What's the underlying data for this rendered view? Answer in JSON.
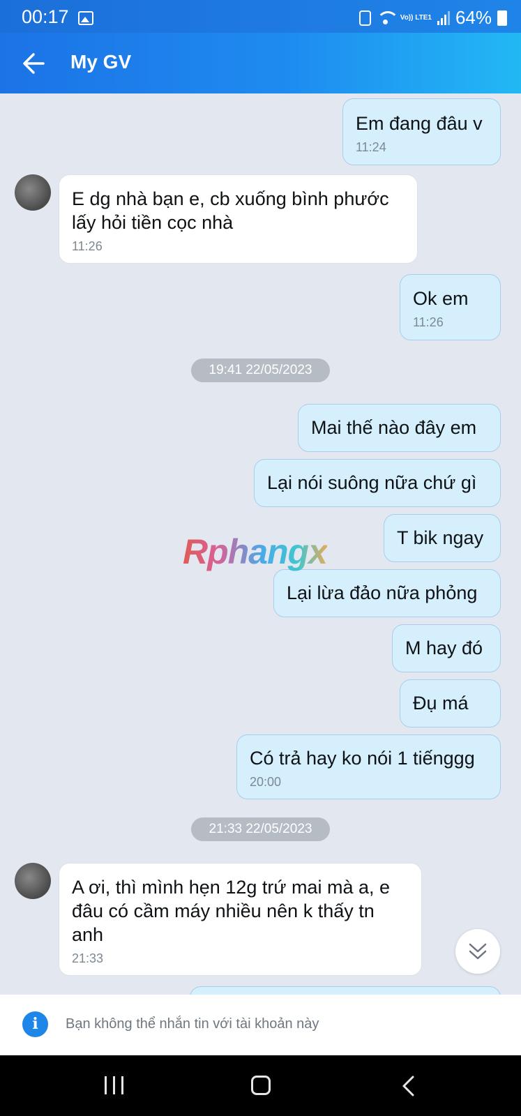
{
  "status_bar": {
    "time": "00:17",
    "battery": "64%",
    "network_label": "Vo)) LTE1"
  },
  "header": {
    "title": "My GV",
    "back_icon": "arrow-left-icon"
  },
  "messages": [
    {
      "direction": "out",
      "text": "Em đang đâu v",
      "time": "11:24"
    },
    {
      "direction": "in",
      "lines": [
        "E dg nhà bạn e, cb xuống bình phước",
        "lấy hỏi tiền cọc nhà"
      ],
      "time": "11:26"
    },
    {
      "direction": "out",
      "text": "Ok em",
      "time": "11:26"
    },
    {
      "direction": "out",
      "text": "Mai thế nào đây em"
    },
    {
      "direction": "out",
      "text": "Lại nói suông nữa chứ gì"
    },
    {
      "direction": "out",
      "text": "T bik ngay"
    },
    {
      "direction": "out",
      "text": "Lại lừa đảo nữa phỏng"
    },
    {
      "direction": "out",
      "text": "M hay đó"
    },
    {
      "direction": "out",
      "text": "Đụ má"
    },
    {
      "direction": "out",
      "text": "Có trả hay ko nói 1 tiếnggg",
      "time": "20:00"
    },
    {
      "direction": "in",
      "lines": [
        "A ơi, thì mình hẹn 12g trứ mai mà a, e",
        "đâu có cầm máy nhiều nên k thấy tn",
        "anh"
      ],
      "time": "21:33"
    }
  ],
  "date_separators": [
    "19:41 22/05/2023",
    "21:33 22/05/2023"
  ],
  "watermark": "Rphangx",
  "footer": {
    "info_text": "Bạn không thể nhắn tin với tài khoản này",
    "info_icon_glyph": "i"
  },
  "colors": {
    "header_start": "#1c73e6",
    "header_end": "#22b8f4",
    "outgoing_bubble": "#d5effd",
    "incoming_bubble": "#ffffff",
    "chat_background": "#e3e8f0"
  }
}
